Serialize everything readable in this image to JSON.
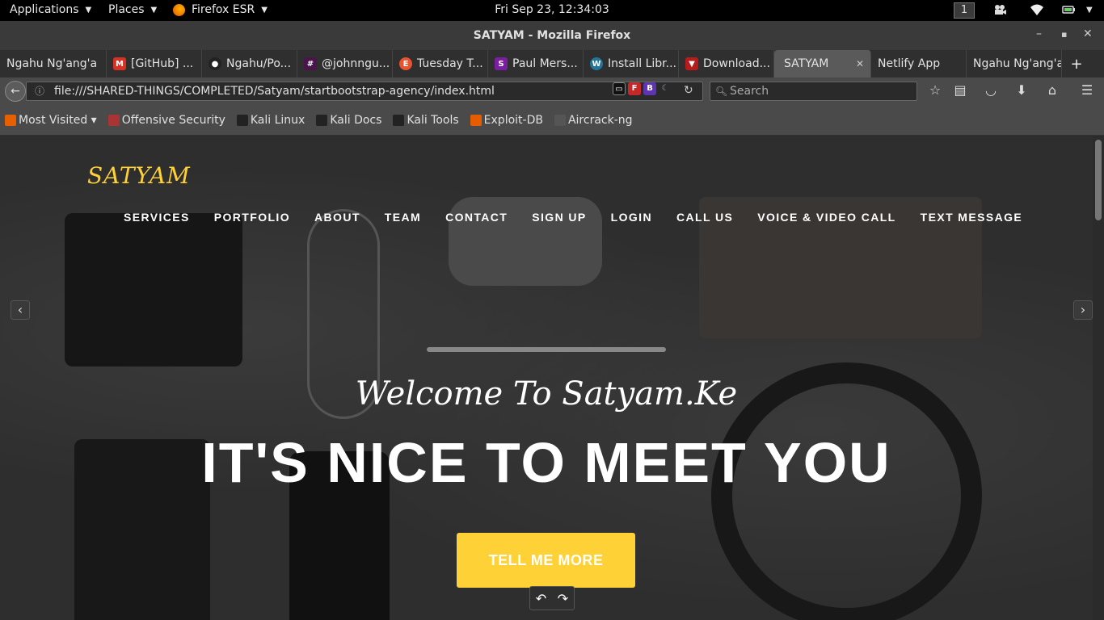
{
  "topbar": {
    "applications": "Applications",
    "places": "Places",
    "app_name": "Firefox ESR",
    "clock": "Fri Sep 23, 12:34:03",
    "workspace": "1"
  },
  "window": {
    "title": "SATYAM - Mozilla Firefox"
  },
  "tabs": [
    {
      "label": "Ngahu Ng'ang'a",
      "icon": "generic"
    },
    {
      "label": "[GitHub] ...",
      "icon": "gmail"
    },
    {
      "label": "Ngahu/Po...",
      "icon": "github"
    },
    {
      "label": "@johnngu...",
      "icon": "slack"
    },
    {
      "label": "Tuesday T...",
      "icon": "e"
    },
    {
      "label": "Paul Mers...",
      "icon": "s"
    },
    {
      "label": "Install Libr...",
      "icon": "wordpress"
    },
    {
      "label": "Download...",
      "icon": "download"
    },
    {
      "label": "SATYAM",
      "icon": "none",
      "active": true
    },
    {
      "label": "Netlify App",
      "icon": "none"
    },
    {
      "label": "Ngahu Ng'ang'a",
      "icon": "generic"
    }
  ],
  "navbar": {
    "url": "file:///SHARED-THINGS/COMPLETED/Satyam/startbootstrap-agency/index.html",
    "search_placeholder": "Search"
  },
  "bookmarks": [
    {
      "label": "Most Visited ▾",
      "color": "#e66000"
    },
    {
      "label": "Offensive Security",
      "color": "#a33"
    },
    {
      "label": "Kali Linux",
      "color": "#222"
    },
    {
      "label": "Kali Docs",
      "color": "#222"
    },
    {
      "label": "Kali Tools",
      "color": "#222"
    },
    {
      "label": "Exploit-DB",
      "color": "#e65c00"
    },
    {
      "label": "Aircrack-ng",
      "color": "#555"
    }
  ],
  "site": {
    "brand": "SATYAM",
    "nav": [
      "SERVICES",
      "PORTFOLIO",
      "ABOUT",
      "TEAM",
      "CONTACT",
      "SIGN UP",
      "LOGIN",
      "CALL US",
      "VOICE & VIDEO CALL",
      "TEXT MESSAGE"
    ],
    "lead": "Welcome To Satyam.Ke",
    "heading": "IT'S NICE TO MEET YOU",
    "cta": "TELL ME MORE"
  },
  "colors": {
    "accent": "#fed136"
  }
}
